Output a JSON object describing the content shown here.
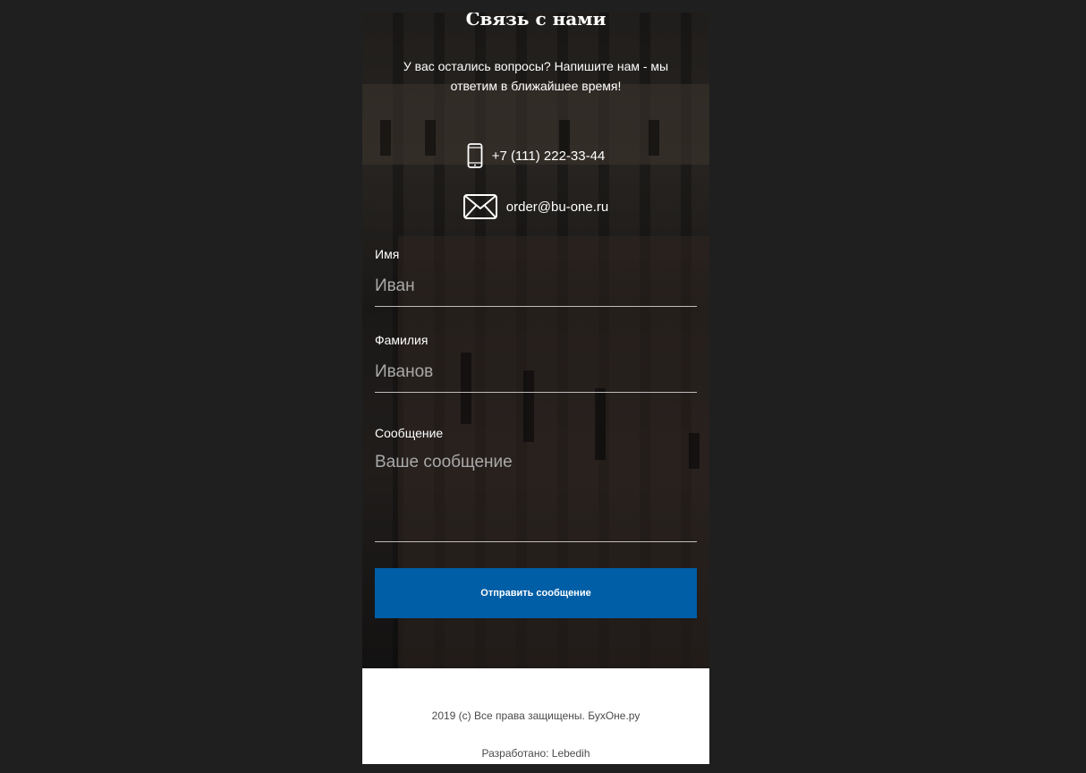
{
  "contact": {
    "title": "Связь с нами",
    "subtitle": "У вас остались вопросы? Напишите нам - мы ответим в ближайшее время!",
    "phone": "+7 (111) 222-33-44",
    "email": "order@bu-one.ru",
    "phone_icon": "phone-icon",
    "email_icon": "envelope-icon"
  },
  "form": {
    "first_name_label": "Имя",
    "first_name_placeholder": "Иван",
    "last_name_label": "Фамилия",
    "last_name_placeholder": "Иванов",
    "message_label": "Сообщение",
    "message_placeholder": "Ваше сообщение",
    "submit_label": "Отправить сообщение"
  },
  "footer": {
    "copyright": "2019 (c) Все права защищены. БухОне.ру",
    "developer": "Разработано: Lebedih"
  },
  "colors": {
    "page_background": "#1f1f20",
    "accent": "#005ea6",
    "footer_background": "#ffffff"
  }
}
